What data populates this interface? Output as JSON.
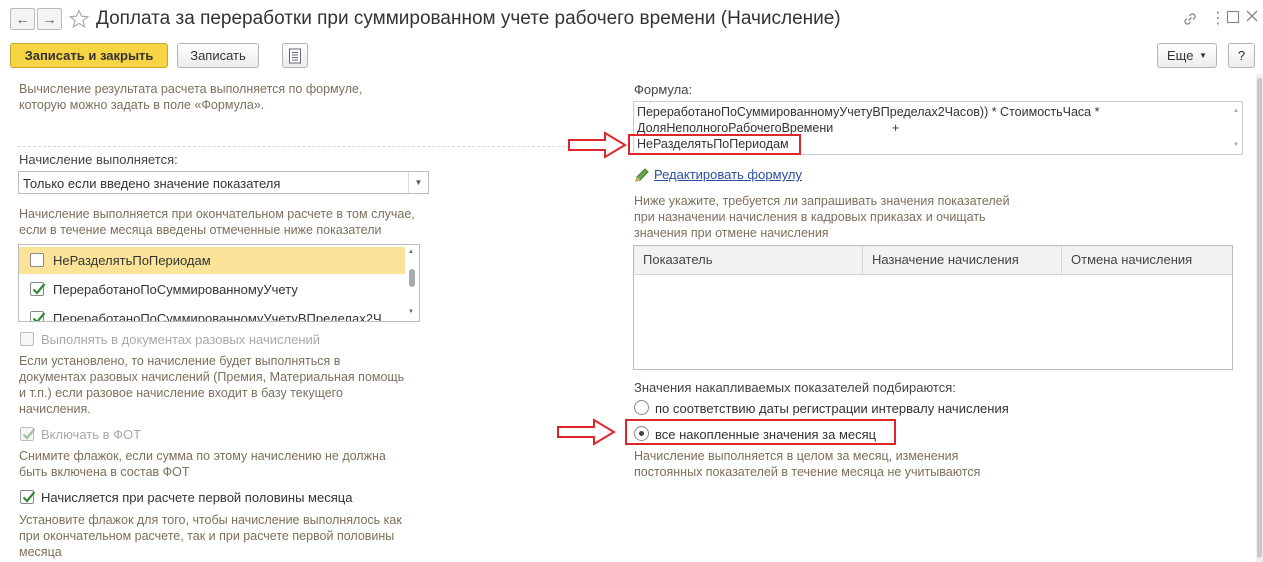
{
  "window": {
    "title": "Доплата за переработки при суммированном учете рабочего времени (Начисление)"
  },
  "toolbar": {
    "save_close": "Записать и закрыть",
    "save": "Записать",
    "more": "Еще",
    "help": "?"
  },
  "left": {
    "intro": [
      "Вычисление результата расчета выполняется по формуле,",
      "которую можно задать в поле «Формула»."
    ],
    "accrual_label": "Начисление выполняется:",
    "accrual_select": "Только если введено значение показателя",
    "accrual_hint": [
      "Начисление выполняется при окончательном расчете в том случае,",
      "если в течение месяца введены отмеченные ниже показатели"
    ],
    "indicators": [
      {
        "label": "НеРазделятьПоПериодам",
        "checked": false
      },
      {
        "label": "ПереработаноПоСуммированномуУчету",
        "checked": true
      },
      {
        "label": "ПереработаноПоСуммированномуУчетуВПределах2Ч",
        "checked": true
      }
    ],
    "one_time_label": "Выполнять в документах разовых начислений",
    "one_time_hint": [
      "Если установлено, то начисление будет выполняться в",
      "документах разовых начислений (Премия, Материальная помощь",
      "и т.п.) если разовое начисление входит в базу текущего",
      "начисления."
    ],
    "fot_label": "Включать в ФОТ",
    "fot_hint": [
      "Снимите флажок, если сумма по этому начислению не должна",
      "быть включена в состав ФОТ"
    ],
    "half_month_label": "Начисляется при расчете первой половины месяца",
    "half_month_hint": [
      "Установите флажок для того, чтобы начисление выполнялось как",
      "при окончательном расчете, так и при расчете первой половины",
      "месяца"
    ]
  },
  "right": {
    "formula_label": "Формула:",
    "formula_lines": [
      "ПереработаноПоСуммированномуУчетуВПределах2Часов)) * СтоимостьЧаса *",
      "ДоляНеполногоРабочегоВремени",
      "+",
      "НеРазделятьПоПериодам"
    ],
    "edit_formula": "Редактировать формулу",
    "request_hint": [
      "Ниже укажите, требуется ли запрашивать значения показателей",
      "при назначении начисления в кадровых приказах и очищать",
      "значения при отмене начисления"
    ],
    "table_headers": [
      "Показатель",
      "Назначение начисления",
      "Отмена начисления"
    ],
    "accum_label": "Значения накапливаемых показателей подбираются:",
    "accum_options": [
      {
        "label": "по соответствию даты регистрации интервалу начисления",
        "selected": false
      },
      {
        "label": "все накопленные значения за месяц",
        "selected": true
      }
    ],
    "accum_hint": [
      "Начисление выполняется в целом за месяц, изменения",
      "постоянных показателей в течение месяца не учитываются"
    ]
  },
  "colors": {
    "accent_yellow": "#f6d443",
    "annotation_red": "#e0262a",
    "hint_text": "#7d6f5c",
    "link": "#2b4fa0",
    "selected_row": "#fbe49a"
  }
}
